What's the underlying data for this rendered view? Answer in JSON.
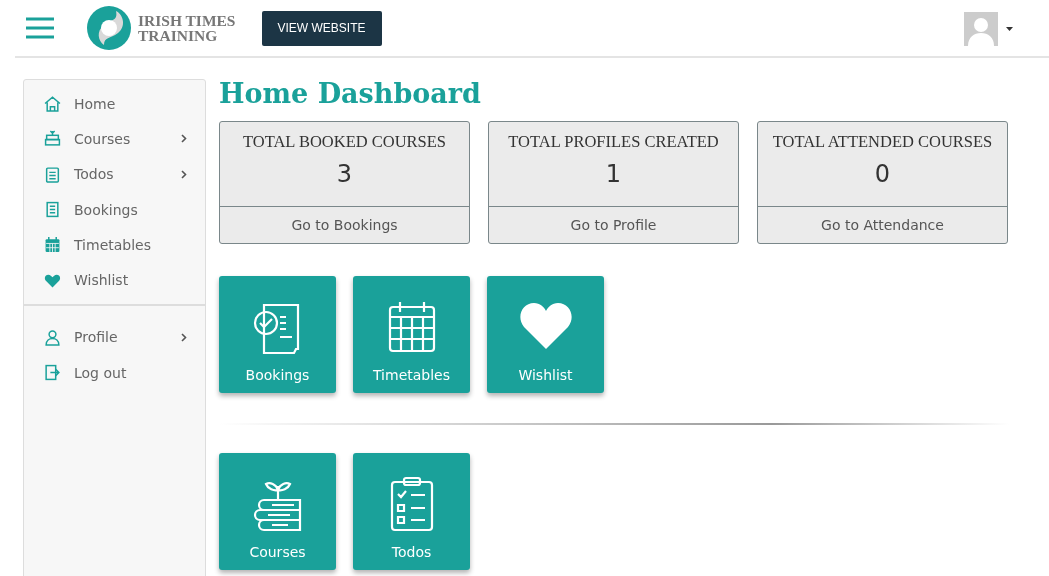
{
  "header": {
    "logo_lines": [
      "IRISH TIMES",
      "TRAINING"
    ],
    "view_website_button": "VIEW WEBSITE"
  },
  "sidebar": {
    "groups": [
      {
        "items": [
          {
            "label": "Home",
            "expandable": false
          },
          {
            "label": "Courses",
            "expandable": true
          },
          {
            "label": "Todos",
            "expandable": true
          },
          {
            "label": "Bookings",
            "expandable": false
          },
          {
            "label": "Timetables",
            "expandable": false
          },
          {
            "label": "Wishlist",
            "expandable": false
          }
        ]
      },
      {
        "items": [
          {
            "label": "Profile",
            "expandable": true
          },
          {
            "label": "Log out",
            "expandable": false
          }
        ]
      }
    ]
  },
  "title": "Home Dashboard",
  "stats": [
    {
      "title": "TOTAL BOOKED COURSES",
      "value": "3",
      "link": "Go to Bookings"
    },
    {
      "title": "TOTAL PROFILES CREATED",
      "value": "1",
      "link": "Go to Profile"
    },
    {
      "title": "TOTAL ATTENDED COURSES",
      "value": "0",
      "link": "Go to Attendance"
    }
  ],
  "tile_rows": [
    [
      {
        "label": "Bookings",
        "kind": "bookings"
      },
      {
        "label": "Timetables",
        "kind": "calendar"
      },
      {
        "label": "Wishlist",
        "kind": "heart"
      }
    ],
    [
      {
        "label": "Courses",
        "kind": "books"
      },
      {
        "label": "Todos",
        "kind": "checklist"
      }
    ]
  ]
}
